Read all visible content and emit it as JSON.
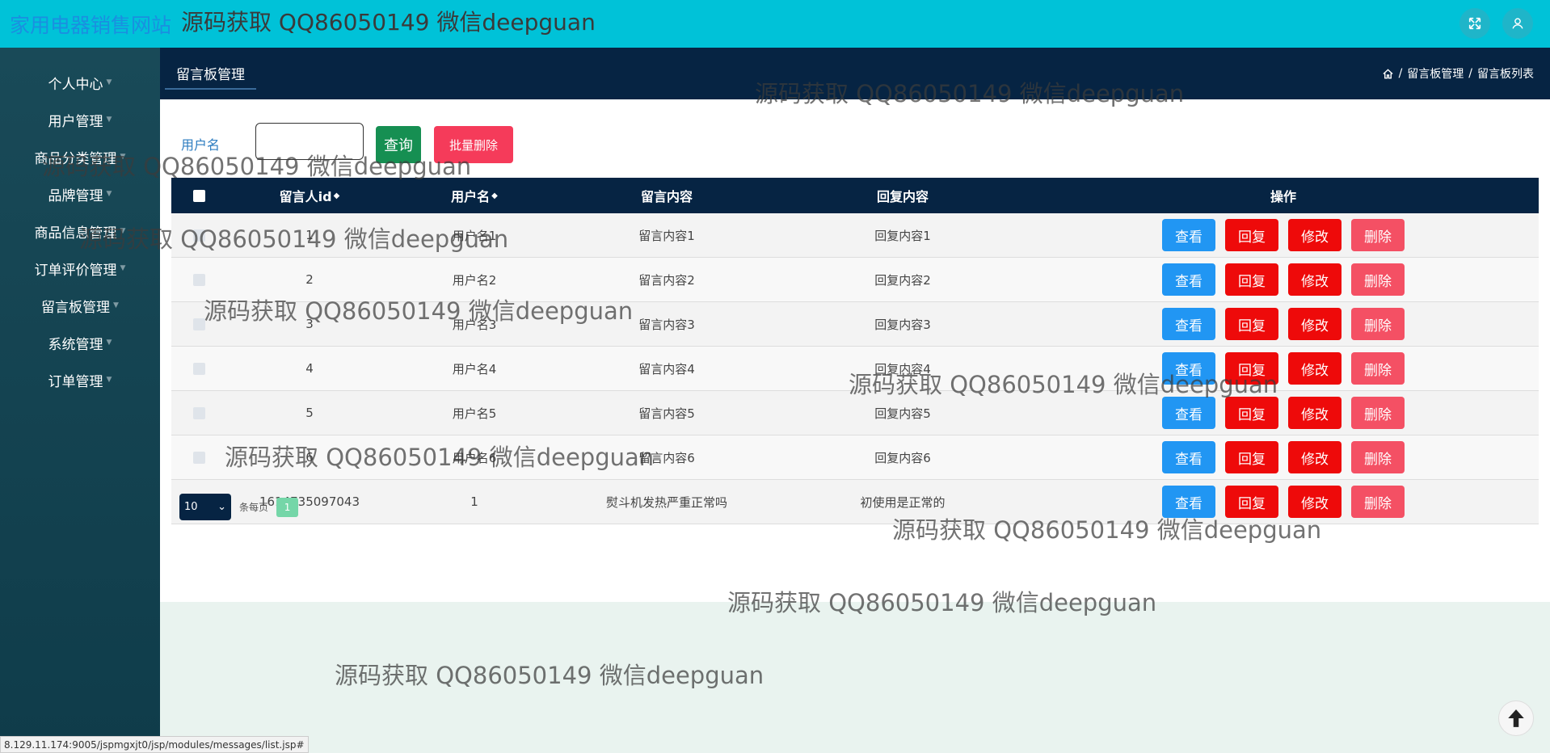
{
  "header": {
    "site_title": "家用电器销售网站",
    "watermark": "源码获取 QQ86050149 微信deepguan"
  },
  "sidebar": {
    "items": [
      {
        "label": "个人中心"
      },
      {
        "label": "用户管理"
      },
      {
        "label": "商品分类管理"
      },
      {
        "label": "品牌管理"
      },
      {
        "label": "商品信息管理"
      },
      {
        "label": "订单评价管理"
      },
      {
        "label": "留言板管理"
      },
      {
        "label": "系统管理"
      },
      {
        "label": "订单管理"
      }
    ]
  },
  "tabs": {
    "active": "留言板管理"
  },
  "breadcrumb": {
    "level1": "留言板管理",
    "separator": "/",
    "level2": "留言板列表"
  },
  "search": {
    "label": "用户名",
    "value": "",
    "query_button": "查询",
    "batch_delete_button": "批量删除"
  },
  "table": {
    "columns": [
      "留言人id",
      "用户名",
      "留言内容",
      "回复内容",
      "操作"
    ],
    "sort_icon": "◆",
    "rows": [
      {
        "id": "1",
        "username": "用户名1",
        "message": "留言内容1",
        "reply": "回复内容1"
      },
      {
        "id": "2",
        "username": "用户名2",
        "message": "留言内容2",
        "reply": "回复内容2"
      },
      {
        "id": "3",
        "username": "用户名3",
        "message": "留言内容3",
        "reply": "回复内容3"
      },
      {
        "id": "4",
        "username": "用户名4",
        "message": "留言内容4",
        "reply": "回复内容4"
      },
      {
        "id": "5",
        "username": "用户名5",
        "message": "留言内容5",
        "reply": "回复内容5"
      },
      {
        "id": "6",
        "username": "用户名6",
        "message": "留言内容6",
        "reply": "回复内容6"
      },
      {
        "id": "1614735097043",
        "username": "1",
        "message": "熨斗机发热严重正常吗",
        "reply": "初使用是正常的"
      }
    ],
    "actions": {
      "view": "查看",
      "reply": "回复",
      "edit": "修改",
      "delete": "删除"
    }
  },
  "pagination": {
    "page_size": "10",
    "per_page_label": "条每页",
    "current_page": "1"
  },
  "status_bar": {
    "url": "8.129.11.174:9005/jspmgxjt0/jsp/modules/messages/list.jsp#"
  },
  "colors": {
    "topbar": "#00c2d8",
    "sidebar": "#0f3c4a",
    "header_dark": "#062443",
    "view_button": "#2196f3",
    "reply_button": "#ee0a0a",
    "delete_button": "#f45064",
    "query_button": "#168f52"
  },
  "icons": [
    "fullscreen-icon",
    "user-icon",
    "home-icon",
    "caret-down-icon",
    "back-to-top-icon",
    "chevron-down-icon"
  ]
}
